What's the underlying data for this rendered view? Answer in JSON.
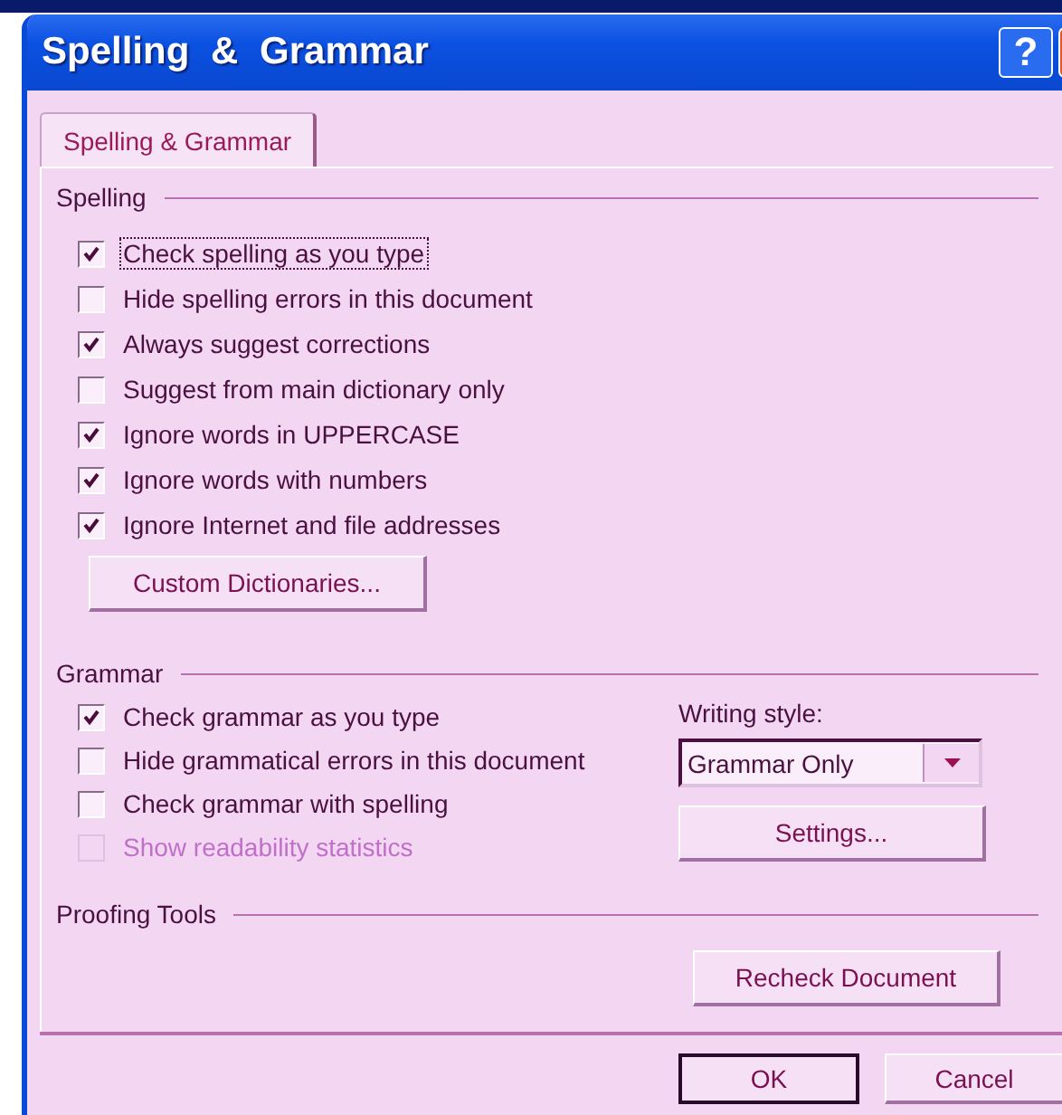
{
  "window": {
    "title": "Spelling & Grammar",
    "buttons": [
      "?"
    ]
  },
  "tabs": [
    {
      "label": "Spelling & Grammar",
      "selected": true
    }
  ],
  "spelling": {
    "heading": "Spelling",
    "options": [
      {
        "label": "Check spelling as you type",
        "checked": true,
        "disabled": false,
        "focused": true
      },
      {
        "label": "Hide spelling errors in this document",
        "checked": false,
        "disabled": false,
        "focused": false
      },
      {
        "label": "Always suggest corrections",
        "checked": true,
        "disabled": false,
        "focused": false
      },
      {
        "label": "Suggest from main dictionary only",
        "checked": false,
        "disabled": false,
        "focused": false
      },
      {
        "label": "Ignore words in UPPERCASE",
        "checked": true,
        "disabled": false,
        "focused": false
      },
      {
        "label": "Ignore words with numbers",
        "checked": true,
        "disabled": false,
        "focused": false
      },
      {
        "label": "Ignore Internet and file addresses",
        "checked": true,
        "disabled": false,
        "focused": false
      }
    ],
    "button": "Custom Dictionaries..."
  },
  "grammar": {
    "heading": "Grammar",
    "options": [
      {
        "label": "Check grammar as you type",
        "checked": true,
        "disabled": false,
        "focused": false
      },
      {
        "label": "Hide grammatical errors in this document",
        "checked": false,
        "disabled": false,
        "focused": false
      },
      {
        "label": "Check grammar with spelling",
        "checked": false,
        "disabled": false,
        "focused": false
      },
      {
        "label": "Show readability statistics",
        "checked": false,
        "disabled": true,
        "focused": false
      }
    ],
    "writing_style_label": "Writing style:",
    "writing_style": "Grammar Only",
    "settings_button": "Settings..."
  },
  "proofing_tools": {
    "heading": "Proofing Tools",
    "button": "Recheck Document"
  },
  "footer_buttons": [
    {
      "label": "OK",
      "default": true
    },
    {
      "label": "Cancel",
      "default": false
    }
  ]
}
